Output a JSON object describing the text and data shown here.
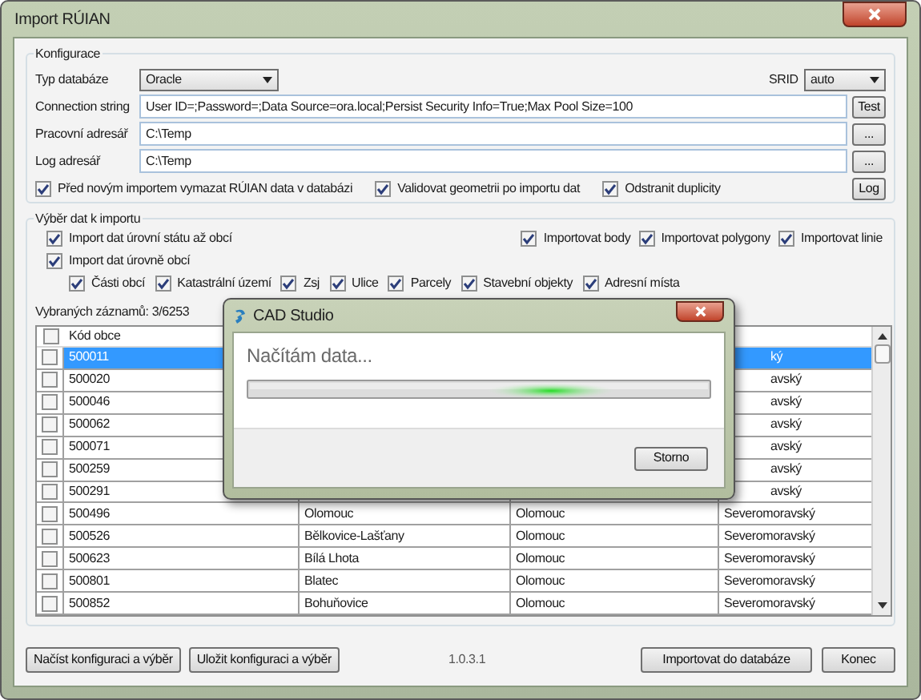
{
  "window": {
    "title": "Import RÚIAN"
  },
  "config": {
    "title": "Konfigurace",
    "db_type": {
      "label": "Typ databáze",
      "value": "Oracle"
    },
    "srid": {
      "label": "SRID",
      "value": "auto"
    },
    "connection": {
      "label": "Connection string",
      "value": "User ID=;Password=;Data Source=ora.local;Persist Security Info=True;Max Pool Size=100",
      "button": "Test"
    },
    "work_dir": {
      "label": "Pracovní adresář",
      "value": "C:\\Temp",
      "button": "..."
    },
    "log_dir": {
      "label": "Log adresář",
      "value": "C:\\Temp",
      "button": "..."
    },
    "options": [
      {
        "label": "Před novým importem vymazat RÚIAN data v databázi",
        "checked": true
      },
      {
        "label": "Validovat geometrii po importu dat",
        "checked": true
      },
      {
        "label": "Odstranit duplicity",
        "checked": true
      }
    ],
    "log_button": "Log"
  },
  "selection": {
    "title": "Výběr dat k importu",
    "levels": [
      {
        "label": "Import dat úrovní státu až obcí",
        "checked": true
      },
      {
        "label": "Import dat úrovně obcí",
        "checked": true,
        "children": [
          {
            "label": "Části obcí",
            "checked": true
          },
          {
            "label": "Katastrální území",
            "checked": true
          },
          {
            "label": "Zsj",
            "checked": true
          },
          {
            "label": "Ulice",
            "checked": true
          },
          {
            "label": "Parcely",
            "checked": true
          },
          {
            "label": "Stavební objekty",
            "checked": true
          },
          {
            "label": "Adresní místa",
            "checked": true
          }
        ]
      }
    ],
    "geometry": [
      {
        "label": "Importovat body",
        "checked": true
      },
      {
        "label": "Importovat polygony",
        "checked": true
      },
      {
        "label": "Importovat linie",
        "checked": true
      }
    ],
    "count": "Vybraných záznamů: 3/6253"
  },
  "table": {
    "header_checked": false,
    "columns": [
      {
        "label": "Kód obce"
      }
    ],
    "rows": [
      {
        "checked": false,
        "selected": true,
        "code": "500011",
        "column_4": "ký"
      },
      {
        "checked": false,
        "selected": false,
        "code": "500020",
        "column_4": "avský"
      },
      {
        "checked": false,
        "selected": false,
        "code": "500046",
        "column_4": "avský"
      },
      {
        "checked": false,
        "selected": false,
        "code": "500062",
        "column_4": "avský"
      },
      {
        "checked": false,
        "selected": false,
        "code": "500071",
        "column_4": "avský"
      },
      {
        "checked": false,
        "selected": false,
        "code": "500259",
        "column_4": "avský"
      },
      {
        "checked": false,
        "selected": false,
        "code": "500291",
        "column_4": "avský"
      },
      {
        "checked": false,
        "selected": false,
        "code": "500496",
        "column_2": "Olomouc",
        "column_3": "Olomouc",
        "column_4": "Severomoravský"
      },
      {
        "checked": false,
        "selected": false,
        "code": "500526",
        "column_2": "Bělkovice-Lašťany",
        "column_3": "Olomouc",
        "column_4": "Severomoravský"
      },
      {
        "checked": false,
        "selected": false,
        "code": "500623",
        "column_2": "Bílá Lhota",
        "column_3": "Olomouc",
        "column_4": "Severomoravský"
      },
      {
        "checked": false,
        "selected": false,
        "code": "500801",
        "column_2": "Blatec",
        "column_3": "Olomouc",
        "column_4": "Severomoravský"
      },
      {
        "checked": false,
        "selected": false,
        "code": "500852",
        "column_2": "Bohuňovice",
        "column_3": "Olomouc",
        "column_4": "Severomoravský"
      }
    ]
  },
  "footer": {
    "load_button": "Načíst konfiguraci a výběr",
    "save_button": "Uložit konfiguraci a výběr",
    "version": "1.0.3.1",
    "import_button": "Importovat do databáze",
    "close_button": "Konec"
  },
  "dialog": {
    "title": "CAD Studio",
    "message": "Načítám data...",
    "progress_indeterminate": true,
    "button": "Storno"
  }
}
